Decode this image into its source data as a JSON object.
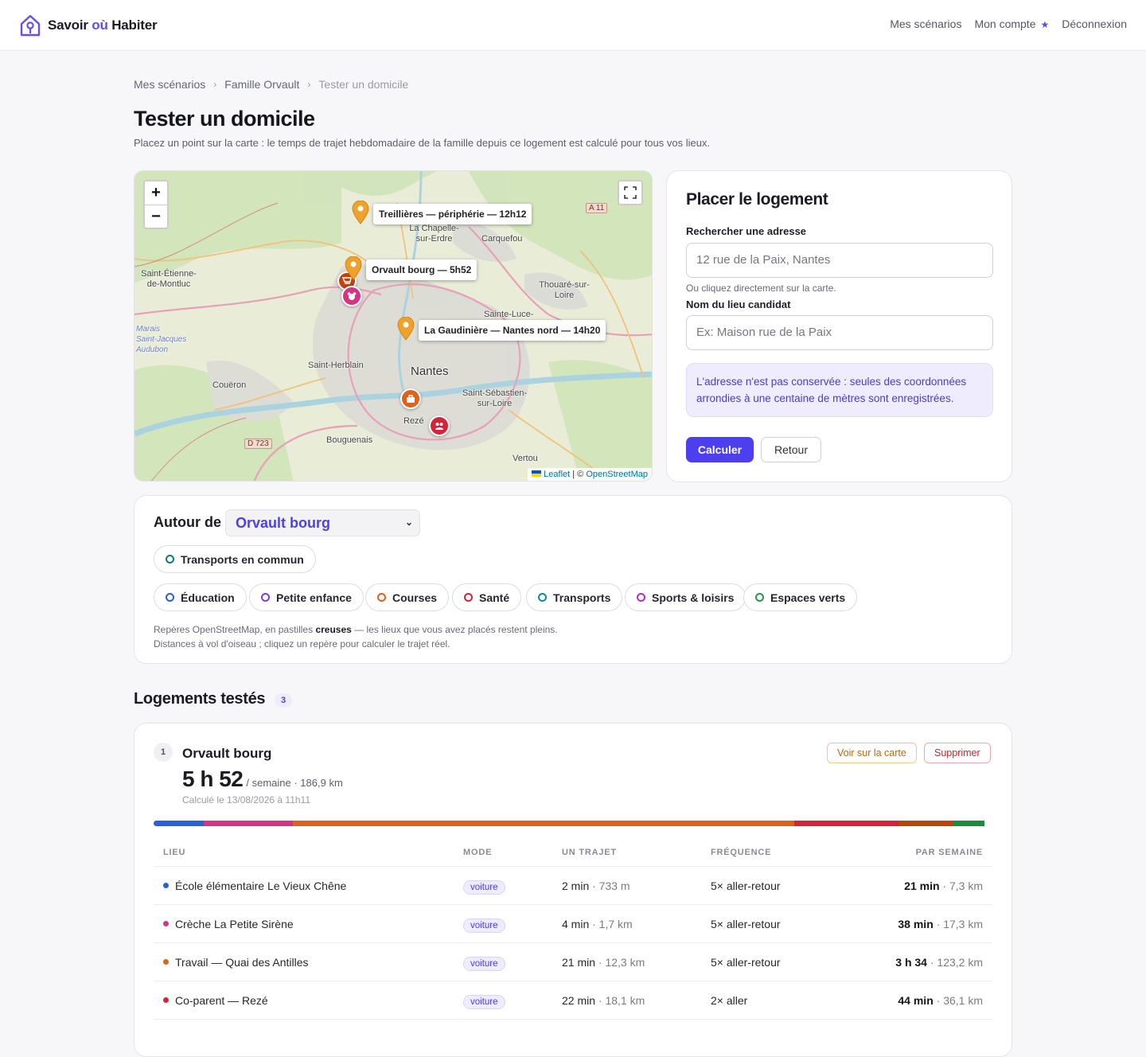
{
  "brand": {
    "name_a": "Savoir ",
    "name_b": "où",
    "name_c": " Habiter"
  },
  "nav": {
    "scenarios": "Mes scénarios",
    "account": "Mon compte",
    "logout": "Déconnexion"
  },
  "breadcrumb": [
    "Mes scénarios",
    "Famille Orvault",
    "Tester un domicile"
  ],
  "page": {
    "title": "Tester un domicile",
    "subtitle": "Placez un point sur la carte : le temps de trajet hebdomadaire de la famille depuis ce logement est calculé pour tous vos lieux."
  },
  "map": {
    "zoom_in": "+",
    "zoom_out": "−",
    "pins": [
      {
        "label": "Treillières — périphérie — 12h12"
      },
      {
        "label": "Orvault bourg — 5h52"
      },
      {
        "label": "La Gaudinière — Nantes nord — 14h20"
      }
    ],
    "places": {
      "nantes": "Nantes",
      "chapelle": "La Chapelle-\nsur-Erdre",
      "carquefou": "Carquefou",
      "thouare": "Thouaré-sur-\nLoire",
      "saint_luce": "Sainte-Luce-",
      "saint_etienne": "Saint-Étienne-\nde-Montluc",
      "saint_herblain": "Saint-Herblain",
      "coueron": "Couëron",
      "saint_sebastien": "Saint-Sébastien-\nsur-Loire",
      "reze": "Rezé",
      "bouguenais": "Bouguenais",
      "vertou": "Vertou",
      "marais": "Marais\nSaint-Jacques\nAudubon"
    },
    "shields": {
      "a11": "A 11",
      "d723": "D 723"
    },
    "attribution_leaflet": "Leaflet",
    "attribution_sep": " | © ",
    "attribution_osm": "OpenStreetMap"
  },
  "form": {
    "title": "Placer le logement",
    "address_label": "Rechercher une adresse",
    "address_placeholder": "12 rue de la Paix, Nantes",
    "address_hint": "Ou cliquez directement sur la carte.",
    "name_label": "Nom du lieu candidat",
    "name_placeholder": "Ex: Maison rue de la Paix",
    "privacy_note": "L'adresse n'est pas conservée : seules des coordonnées arrondies à une centaine de mètres sont enregistrées.",
    "submit": "Calculer",
    "back": "Retour"
  },
  "around": {
    "label": "Autour de",
    "selected": "Orvault bourg",
    "chips": [
      {
        "label": "Transports en commun",
        "color": "#0f7a6e"
      },
      {
        "label": "Éducation",
        "color": "#2b5fd9"
      },
      {
        "label": "Petite enfance",
        "color": "#7b3fe0"
      },
      {
        "label": "Courses",
        "color": "#e0611a"
      },
      {
        "label": "Santé",
        "color": "#d4233a"
      },
      {
        "label": "Transports",
        "color": "#0f8a98"
      },
      {
        "label": "Sports & loisirs",
        "color": "#b12fc7"
      },
      {
        "label": "Espaces verts",
        "color": "#1d9a4b"
      }
    ],
    "help_a": "Repères OpenStreetMap, en pastilles ",
    "help_b": "creuses",
    "help_c": " — les lieux que vous avez placés restent pleins.",
    "help_d": "Distances à vol d'oiseau ; cliquez un repère pour calculer le trajet réel."
  },
  "tested": {
    "title": "Logements testés",
    "count": "3",
    "card": {
      "rank": "1",
      "name": "Orvault bourg",
      "time": "5 h 52",
      "per_week": "/ semaine · 186,9 km",
      "computed": "Calculé le 13/08/2026 à 11h11",
      "btn_map": "Voir sur la carte",
      "btn_delete": "Supprimer",
      "stack": [
        {
          "color": "#2b5fd9",
          "share": 6
        },
        {
          "color": "#d63384",
          "share": 10.6
        },
        {
          "color": "#e0611a",
          "share": 59.8
        },
        {
          "color": "#d4233a",
          "share": 12.5
        },
        {
          "color": "#b8460f",
          "share": 6.5
        },
        {
          "color": "#1d8a3e",
          "share": 3.7
        }
      ],
      "headers": {
        "lieu": "LIEU",
        "mode": "MODE",
        "trajet": "UN TRAJET",
        "freq": "FRÉQUENCE",
        "week": "PAR SEMAINE"
      },
      "rows": [
        {
          "place": "École élémentaire Le Vieux Chêne",
          "color": "#2b5fd9",
          "mode": "voiture",
          "trip_t": "2 min",
          "trip_d": " · 733 m",
          "freq": "5× aller-retour",
          "week_t": "21 min",
          "week_d": " · 7,3 km"
        },
        {
          "place": "Crèche La Petite Sirène",
          "color": "#d63384",
          "mode": "voiture",
          "trip_t": "4 min",
          "trip_d": " · 1,7 km",
          "freq": "5× aller-retour",
          "week_t": "38 min",
          "week_d": " · 17,3 km"
        },
        {
          "place": "Travail — Quai des Antilles",
          "color": "#e0611a",
          "mode": "voiture",
          "trip_t": "21 min",
          "trip_d": " · 12,3 km",
          "freq": "5× aller-retour",
          "week_t": "3 h 34",
          "week_d": " · 123,2 km"
        },
        {
          "place": "Co-parent — Rezé",
          "color": "#d4233a",
          "mode": "voiture",
          "trip_t": "22 min",
          "trip_d": " · 18,1 km",
          "freq": "2× aller",
          "week_t": "44 min",
          "week_d": " · 36,1 km"
        }
      ]
    }
  }
}
